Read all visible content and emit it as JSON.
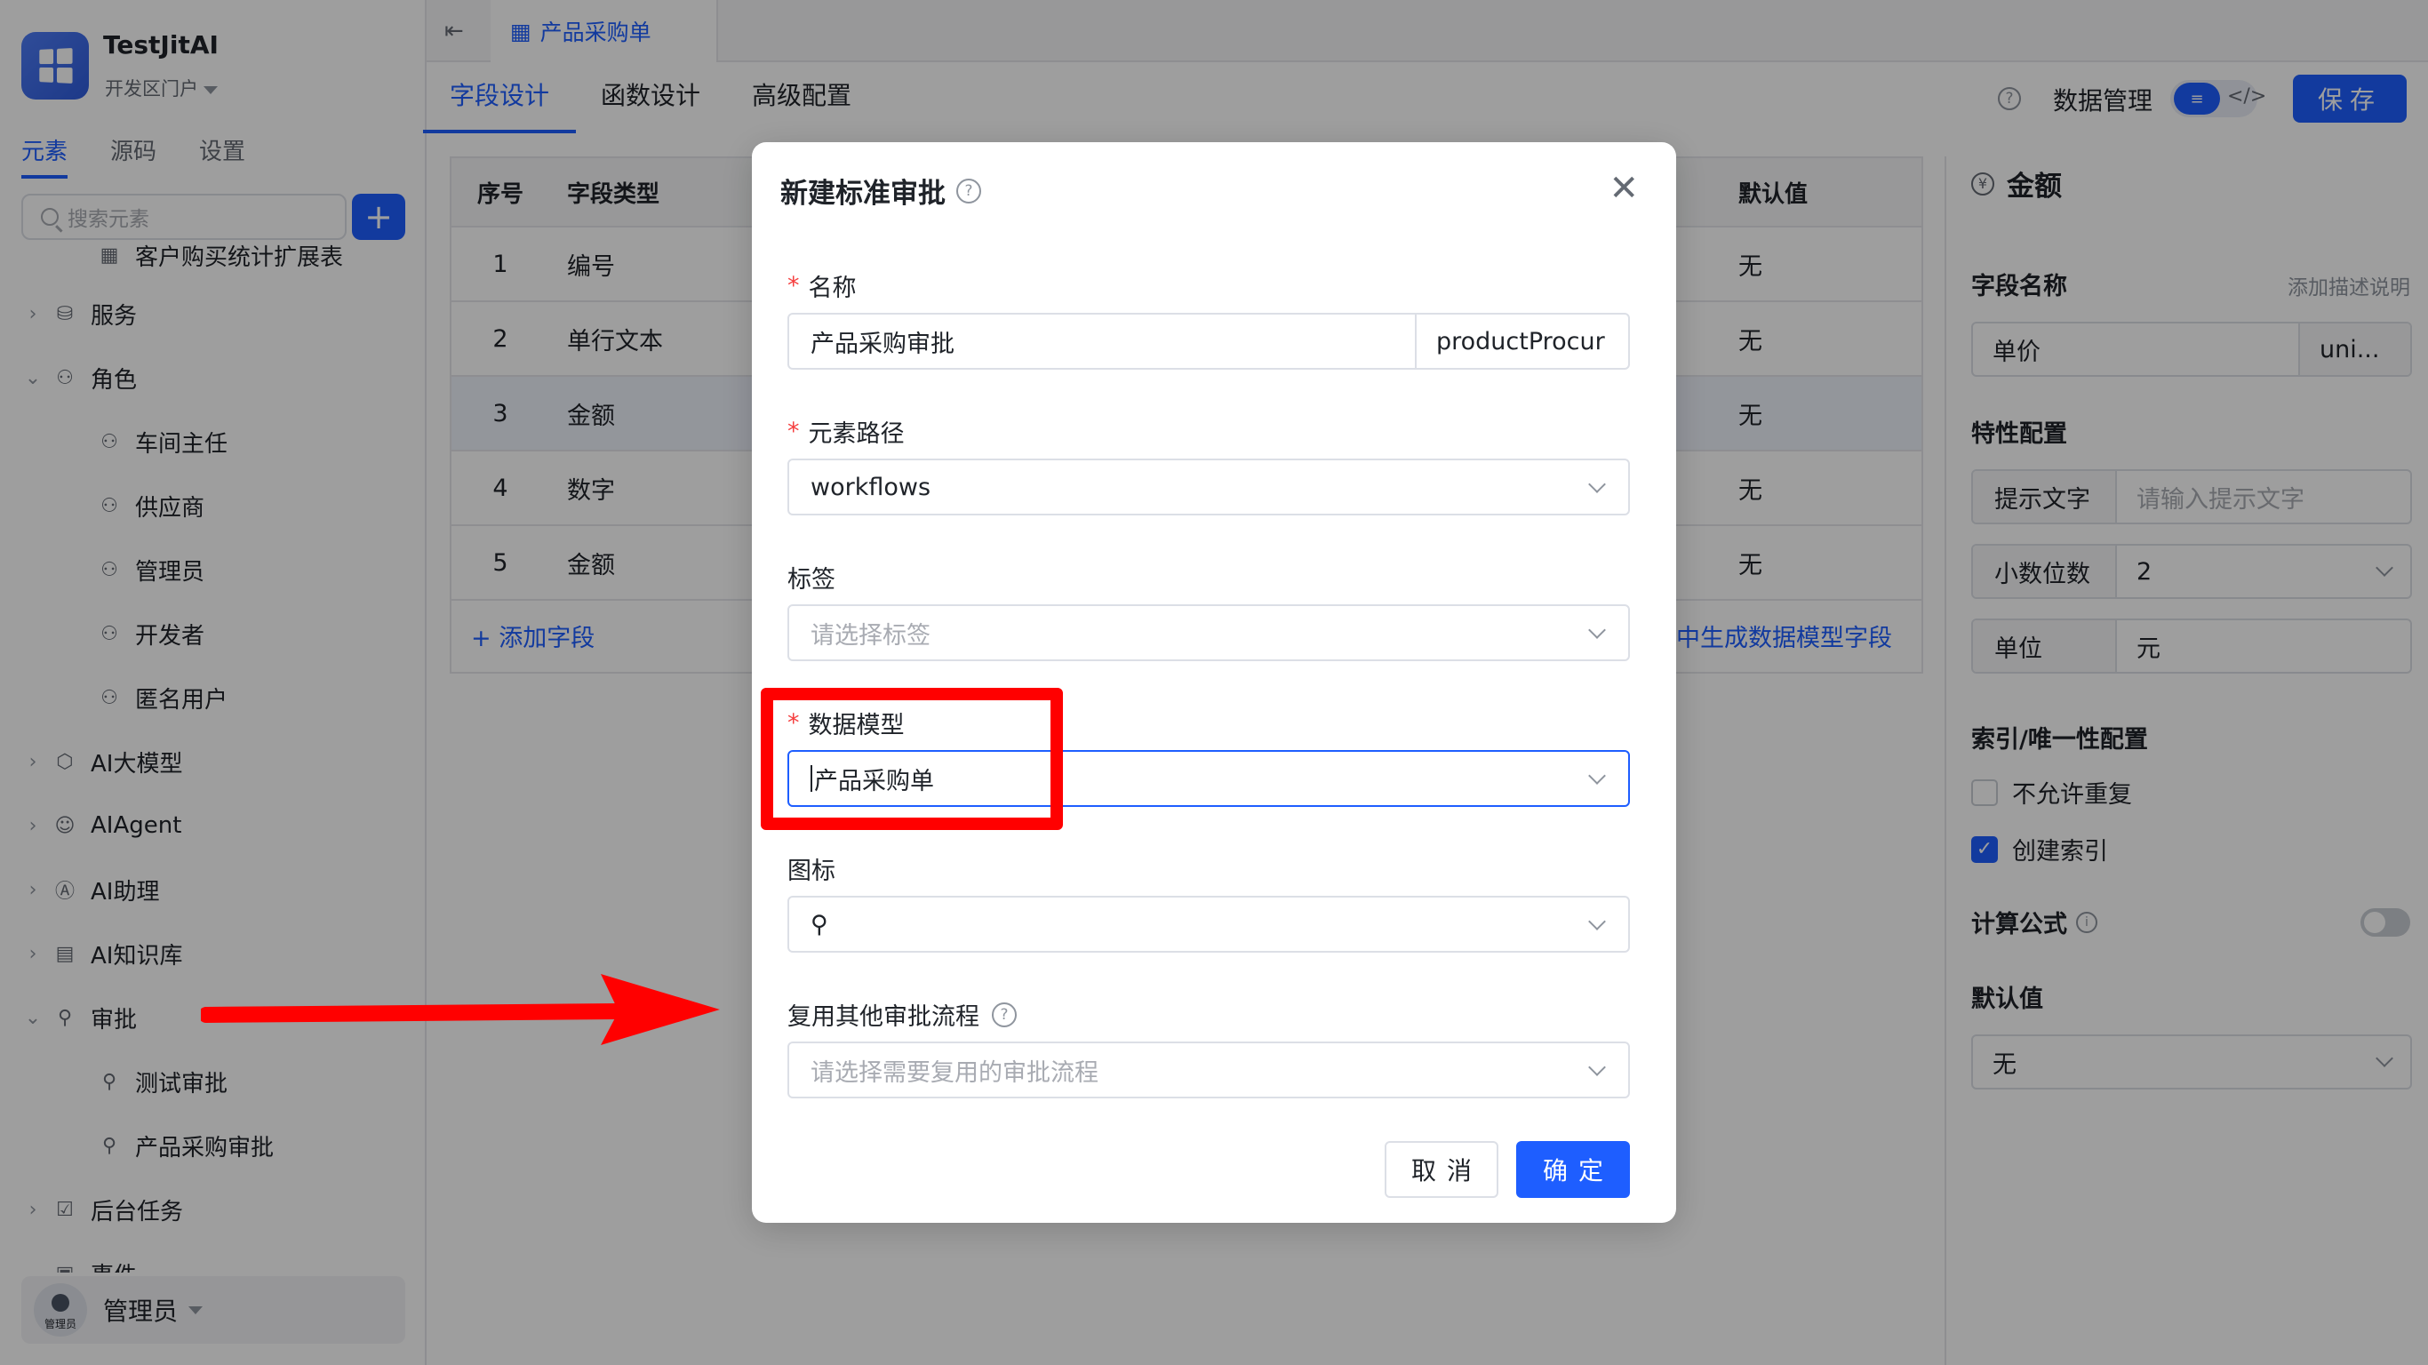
{
  "app": {
    "name": "TestJitAI",
    "portal": "开发区门户"
  },
  "sidebar": {
    "tabs": [
      "元素",
      "源码",
      "设置"
    ],
    "search_placeholder": "搜索元素",
    "add_button": "+",
    "items": [
      {
        "label": "客户购买统计扩展表",
        "icon": "table-icon"
      },
      {
        "label": "服务",
        "icon": "database-icon"
      },
      {
        "label": "角色",
        "icon": "person-icon"
      },
      {
        "label": "车间主任",
        "icon": "person-icon"
      },
      {
        "label": "供应商",
        "icon": "person-icon"
      },
      {
        "label": "管理员",
        "icon": "person-icon"
      },
      {
        "label": "开发者",
        "icon": "person-icon"
      },
      {
        "label": "匿名用户",
        "icon": "person-icon"
      },
      {
        "label": "AI大模型",
        "icon": "cube-icon"
      },
      {
        "label": "AIAgent",
        "icon": "robot-icon"
      },
      {
        "label": "AI助理",
        "icon": "ai-icon"
      },
      {
        "label": "AI知识库",
        "icon": "book-icon"
      },
      {
        "label": "审批",
        "icon": "stamp-icon"
      },
      {
        "label": "测试审批",
        "icon": "stamp-icon"
      },
      {
        "label": "产品采购审批",
        "icon": "stamp-icon"
      },
      {
        "label": "后台任务",
        "icon": "task-icon"
      },
      {
        "label": "事件",
        "icon": "event-icon"
      }
    ],
    "user": {
      "avatar_text": "管理员",
      "name": "管理员"
    }
  },
  "topbar": {
    "tab_label": "产品采购单"
  },
  "subtabs": [
    "字段设计",
    "函数设计",
    "高级配置"
  ],
  "header_actions": {
    "data_mgmt": "数据管理",
    "save": "保存"
  },
  "table": {
    "headers": {
      "no": "序号",
      "type": "字段类型",
      "default": "默认值"
    },
    "rows": [
      {
        "no": "1",
        "type": "编号",
        "default": "无"
      },
      {
        "no": "2",
        "type": "单行文本",
        "default": "无"
      },
      {
        "no": "3",
        "type": "金额",
        "default": "无"
      },
      {
        "no": "4",
        "type": "数字",
        "default": "无"
      },
      {
        "no": "5",
        "type": "金额",
        "default": "无"
      }
    ],
    "add_field": "+ 添加字段",
    "gen_field": "中生成数据模型字段"
  },
  "right_panel": {
    "title": "金额",
    "field_name_label": "字段名称",
    "add_desc": "添加描述说明",
    "field_name_value": "单价",
    "field_name_code": "uni...",
    "feature_label": "特性配置",
    "hint_label": "提示文字",
    "hint_placeholder": "请输入提示文字",
    "decimals_label": "小数位数",
    "decimals_value": "2",
    "unit_label": "单位",
    "unit_value": "元",
    "index_label": "索引/唯一性配置",
    "no_dup": "不允许重复",
    "create_index": "创建索引",
    "formula_label": "计算公式",
    "default_label": "默认值",
    "default_value": "无"
  },
  "modal": {
    "title": "新建标准审批",
    "name_label": "名称",
    "name_value": "产品采购审批",
    "name_code": "productProcur",
    "path_label": "元素路径",
    "path_value": "workflows",
    "tag_label": "标签",
    "tag_placeholder": "请选择标签",
    "model_label": "数据模型",
    "model_value": "产品采购单",
    "icon_label": "图标",
    "reuse_label": "复用其他审批流程",
    "reuse_placeholder": "请选择需要复用的审批流程",
    "cancel": "取消",
    "ok": "确定"
  }
}
